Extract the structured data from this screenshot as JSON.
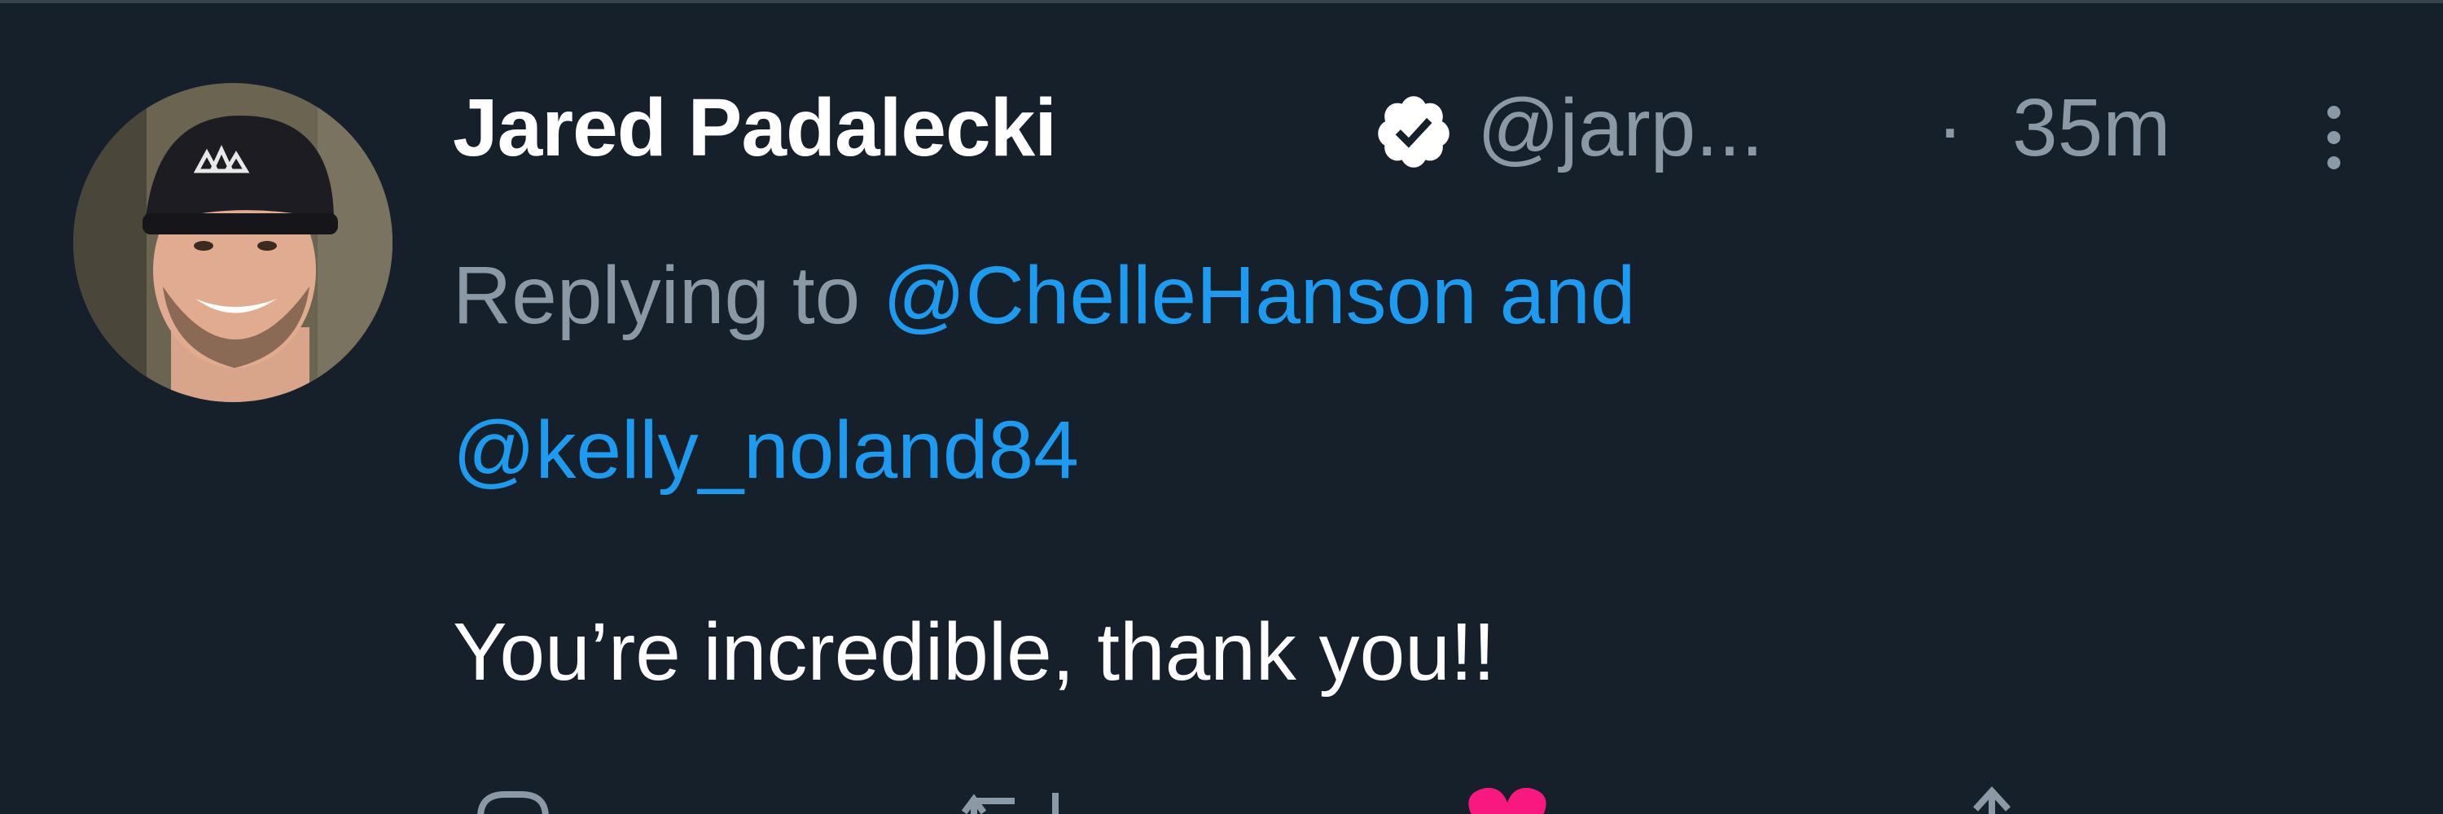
{
  "tweet": {
    "author_name": "Jared Padalecki",
    "author_handle": "@jarp...",
    "separator": "·",
    "time": "35m",
    "replying_to_prefix": "Replying to",
    "replying_to_mention_1": "@ChelleHanson",
    "replying_to_and": "and",
    "replying_to_mention_2": "@kelly_noland84",
    "text": "You’re incredible, thank you!!"
  },
  "icons": {
    "verified": "verified-badge-icon",
    "more": "more-vertical-icon",
    "reply": "reply-icon",
    "retweet": "retweet-icon",
    "like": "heart-icon",
    "share": "share-icon"
  },
  "colors": {
    "background": "#15202b",
    "name": "#ffffff",
    "secondary": "#8b98a5",
    "mention": "#1d9bf0",
    "like": "#f91880"
  }
}
